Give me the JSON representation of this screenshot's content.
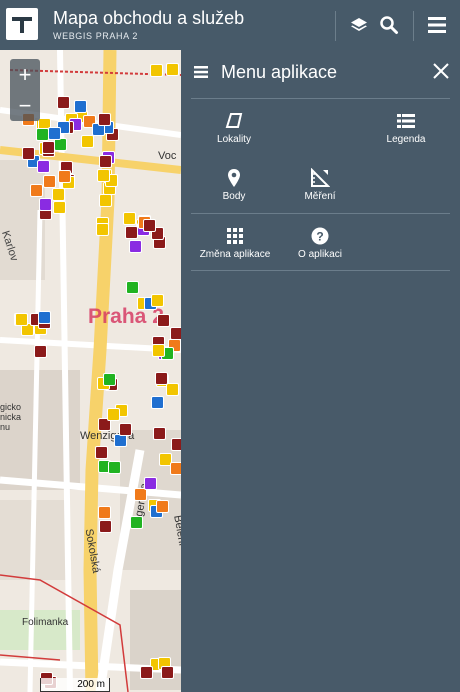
{
  "header": {
    "title": "Mapa obchodu a služeb",
    "subtitle": "WEBGIS PRAHA 2"
  },
  "icons": {
    "layers": "layers-icon",
    "search": "search-icon",
    "menu": "hamburger-icon",
    "close": "close-icon"
  },
  "map": {
    "scale_label": "200 m",
    "street_labels": [
      "Voc",
      "Karlov",
      "Wenzigova",
      "Legerova",
      "Sokolská",
      "Bělehr",
      "Folimanka",
      "gicko",
      "nicka",
      "nu"
    ],
    "district_label": "Praha 2",
    "zoom_in": "+",
    "zoom_out": "−"
  },
  "menu": {
    "title": "Menu aplikace",
    "items": [
      {
        "label": "Lokality",
        "icon": "polygon-icon"
      },
      {
        "label": "Legenda",
        "icon": "legend-list-icon"
      },
      {
        "label": "Body",
        "icon": "map-pin-icon"
      },
      {
        "label": "Měření",
        "icon": "ruler-icon"
      },
      {
        "label": "Změna aplikace",
        "icon": "grid-icon"
      },
      {
        "label": "O aplikaci",
        "icon": "help-icon"
      }
    ]
  },
  "colors": {
    "header_bg": "#475a69",
    "panel_bg": "#485a69",
    "poi_dark_red": "#8b1a1a",
    "poi_yellow": "#f2c500",
    "poi_blue": "#1f6fd0",
    "poi_orange": "#f07a1a",
    "poi_green": "#21b321",
    "poi_purple": "#8a2be2",
    "road_yellow": "#f7d26a"
  }
}
